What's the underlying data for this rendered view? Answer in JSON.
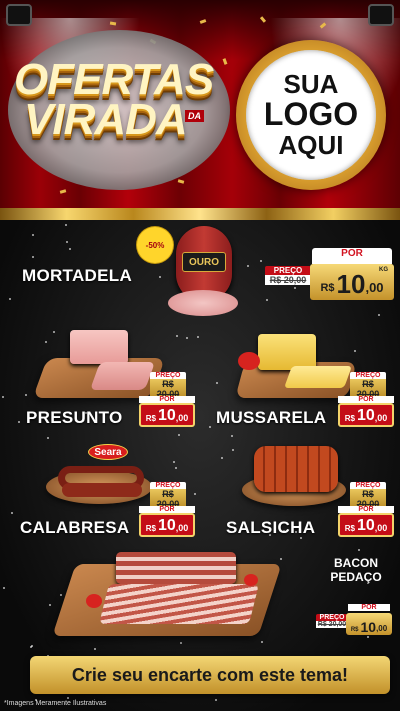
{
  "header": {
    "title_line1": "OFERTAS",
    "title_line2": "VIRADA",
    "title_tag": "DA",
    "logo_lines": [
      "SUA",
      "LOGO",
      "AQUI"
    ]
  },
  "products": {
    "mortadela": {
      "name": "MORTADELA",
      "badge": "-50%",
      "brand": "OURO",
      "price_label": "PREÇO",
      "old_price": "R$ 20,00",
      "por_label": "POR",
      "currency": "R$",
      "price": "10",
      "cents": ",00",
      "unit": "KG"
    },
    "presunto": {
      "name": "PRESUNTO",
      "price_label": "PREÇO",
      "old_price": "R$ 20,00",
      "por_label": "POR",
      "currency": "R$",
      "price": "10",
      "cents": ",00"
    },
    "mussarela": {
      "name": "MUSSARELA",
      "price_label": "PREÇO",
      "old_price": "R$ 20,00",
      "por_label": "POR",
      "currency": "R$",
      "price": "10",
      "cents": ",00"
    },
    "calabresa": {
      "name": "CALABRESA",
      "brand": "Seara",
      "price_label": "PREÇO",
      "old_price": "R$ 20,00",
      "por_label": "POR",
      "currency": "R$",
      "price": "10",
      "cents": ",00"
    },
    "salsicha": {
      "name": "SALSICHA",
      "price_label": "PREÇO",
      "old_price": "R$ 20,00",
      "por_label": "POR",
      "currency": "R$",
      "price": "10",
      "cents": ",00"
    },
    "bacon": {
      "name_line1": "BACON",
      "name_line2": "PEDAÇO",
      "price_label": "PREÇO",
      "old_price": "R$ 20,00",
      "por_label": "POR",
      "currency": "R$",
      "price": "10",
      "cents": ",00"
    }
  },
  "cta": "Crie seu encarte com este tema!",
  "disclaimer": "*Imagens Meramente Ilustrativas"
}
